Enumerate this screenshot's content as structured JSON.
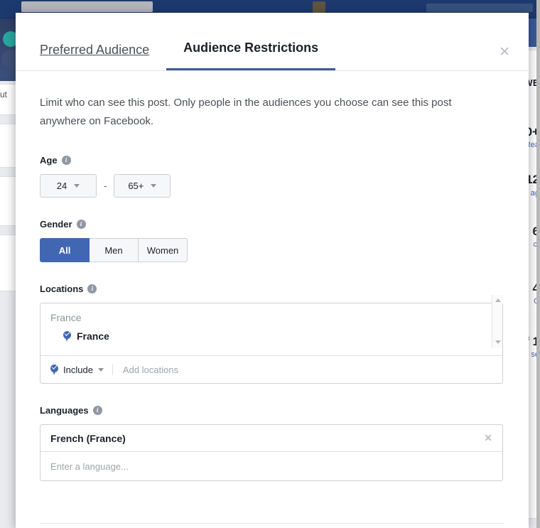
{
  "background": {
    "left_fragments": [
      "ut"
    ],
    "right_fragments": [
      {
        "head": "WE"
      },
      {
        "big": "0+",
        "small": "Rea"
      },
      {
        "big": "12",
        "small": "ag"
      },
      {
        "big": "6",
        "small": "ct"
      },
      {
        "big": "4",
        "small": "C"
      },
      {
        "big": "f 1",
        "small": "se"
      }
    ]
  },
  "modal": {
    "tabs": [
      {
        "label": "Preferred Audience",
        "active": false
      },
      {
        "label": "Audience Restrictions",
        "active": true
      }
    ],
    "close_label": "✕",
    "description": "Limit who can see this post. Only people in the audiences you choose can see this post anywhere on Facebook.",
    "info_glyph": "i",
    "age": {
      "label": "Age",
      "min_value": "24",
      "max_value": "65+",
      "separator": "-"
    },
    "gender": {
      "label": "Gender",
      "options": [
        {
          "label": "All",
          "selected": true
        },
        {
          "label": "Men",
          "selected": false
        },
        {
          "label": "Women",
          "selected": false
        }
      ]
    },
    "locations": {
      "label": "Locations",
      "group_header": "France",
      "selected": [
        {
          "name": "France"
        }
      ],
      "include_label": "Include",
      "placeholder": "Add locations"
    },
    "languages": {
      "label": "Languages",
      "selected": [
        {
          "name": "French (France)",
          "remove_label": "✕"
        }
      ],
      "placeholder": "Enter a language..."
    }
  },
  "colors": {
    "accent": "#4267b2",
    "tab_underline": "#3b5998",
    "topbar": "#1d3a6e",
    "page_bg": "#e9ebee",
    "text_primary": "#1d2129",
    "text_secondary": "#4b4f56",
    "placeholder": "#a0a4ab"
  }
}
